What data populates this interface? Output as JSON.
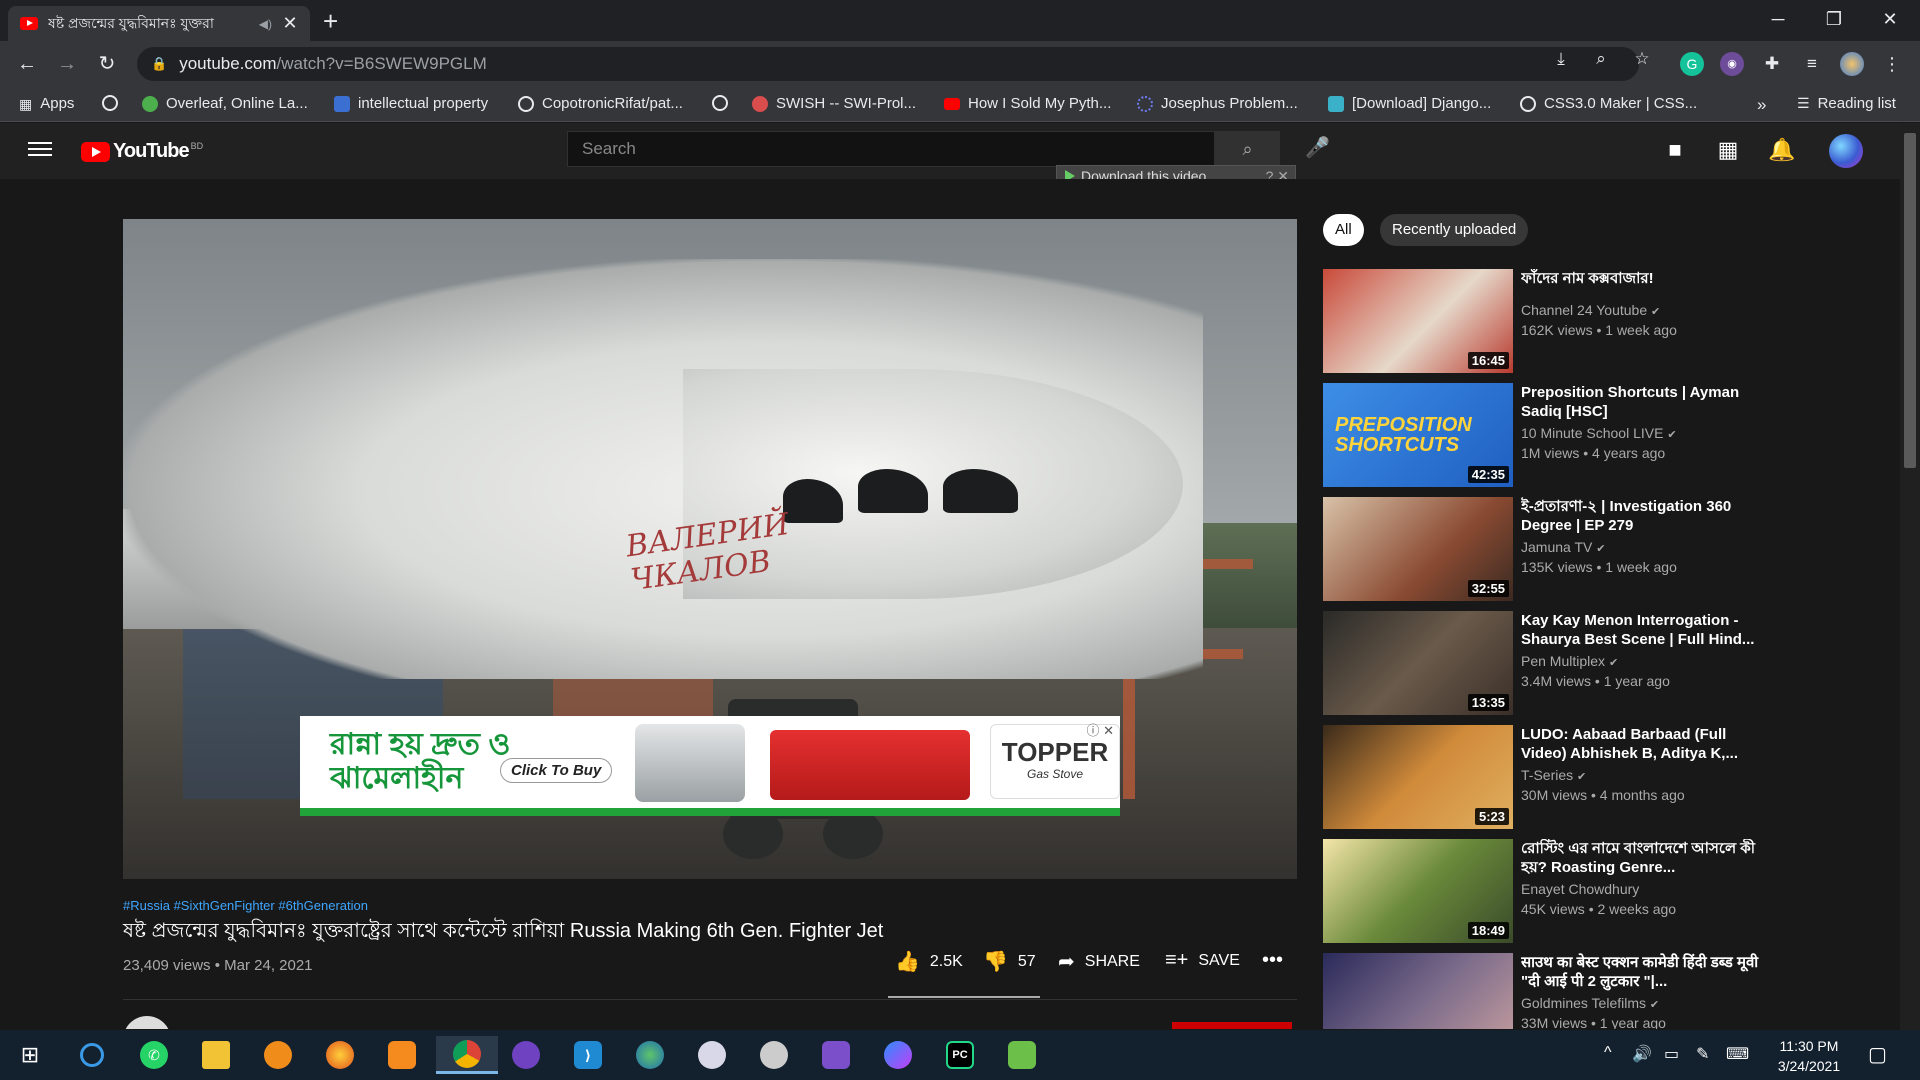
{
  "browser": {
    "tab_title": "ষষ্ট প্রজন্মের যুদ্ধবিমানঃ যুক্তরা",
    "tab_audio_icon": "speaker-icon",
    "url_host": "youtube.com",
    "url_path": "/watch?v=B6SWEW9PGLM",
    "bookmarks": [
      {
        "label": "Apps",
        "color": "#4285f4"
      },
      {
        "label": "",
        "color": "#e8eaed"
      },
      {
        "label": "Overleaf, Online La...",
        "color": "#4cae4c"
      },
      {
        "label": "intellectual property",
        "color": "#3b6fd1"
      },
      {
        "label": "CopotronicRifat/pat...",
        "color": "#e8eaed"
      },
      {
        "label": "",
        "color": "#e8eaed"
      },
      {
        "label": "SWISH -- SWI-Prol...",
        "color": "#d94d4d"
      },
      {
        "label": "How I Sold My Pyth...",
        "color": "#ff0000"
      },
      {
        "label": "Josephus Problem...",
        "color": "#6f7cf0"
      },
      {
        "label": "[Download] Django...",
        "color": "#3bb0c9"
      },
      {
        "label": "CSS3.0 Maker | CSS...",
        "color": "#e8eaed"
      }
    ],
    "more_bookmarks": "»",
    "reading_list": "Reading list"
  },
  "youtube": {
    "country_code": "BD",
    "logo_text": "YouTube",
    "search_placeholder": "Search",
    "download_bar": "Download this video",
    "chips": [
      "All",
      "Recently uploaded"
    ]
  },
  "video": {
    "hashtags": "#Russia #SixthGenFighter #6thGeneration",
    "title": "ষষ্ট প্রজন্মের যুদ্ধবিমানঃ যুক্তরাষ্ট্রের সাথে কন্টেস্টে রাশিয়া Russia Making 6th Gen. Fighter Jet",
    "views_date": "23,409 views • Mar 24, 2021",
    "likes": "2.5K",
    "dislikes": "57",
    "share_label": "SHARE",
    "save_label": "SAVE",
    "plane_text_line1": "ВАЛЕРИЙ",
    "plane_text_line2": "ЧКАЛОВ",
    "ad": {
      "headline_line1": "রান্না হয় দ্রুত ও",
      "headline_line2": "ঝামেলাহীন",
      "cta": "Click To Buy",
      "brand": "TOPPER",
      "brand_sub": "Gas Stove"
    }
  },
  "recommendations": [
    {
      "title": "ফাঁদের নাম কক্সবাজার!",
      "channel": "Channel 24 Youtube",
      "meta": "162K views • 1 week ago",
      "duration": "16:45",
      "thumb_color": "#b83a2e"
    },
    {
      "title": "Preposition Shortcuts | Ayman Sadiq [HSC]",
      "channel": "10 Minute School LIVE",
      "meta": "1M views • 4 years ago",
      "duration": "42:35",
      "thumb_color": "#1f6fd1",
      "thumb_text": "PREPOSITION SHORTCUTS"
    },
    {
      "title": "ই-প্রতারণা-২ | Investigation 360 Degree | EP 279",
      "channel": "Jamuna TV",
      "meta": "135K views • 1 week ago",
      "duration": "32:55",
      "thumb_color": "#7a3b2a"
    },
    {
      "title": "Kay Kay Menon Interrogation - Shaurya Best Scene | Full Hind...",
      "channel": "Pen Multiplex",
      "meta": "3.4M views • 1 year ago",
      "duration": "13:35",
      "thumb_color": "#5a4a3c"
    },
    {
      "title": "LUDO: Aabaad Barbaad (Full Video) Abhishek B, Aditya K,...",
      "channel": "T-Series",
      "meta": "30M views • 4 months ago",
      "duration": "5:23",
      "thumb_color": "#b4702c"
    },
    {
      "title": "রোস্টিং এর নামে বাংলাদেশে আসলে কী হয়? Roasting Genre...",
      "channel": "Enayet Chowdhury",
      "meta": "45K views • 2 weeks ago",
      "duration": "18:49",
      "thumb_color": "#c9a23a"
    },
    {
      "title": "साउथ का बेस्ट एक्शन कामेडी हिंदी डब्ड मूवी \"दी आई पी 2 लुटकार \"|...",
      "channel": "Goldmines Telefilms",
      "meta": "33M views • 1 year ago",
      "duration": "",
      "thumb_color": "#6a5a7a"
    }
  ],
  "taskbar": {
    "time": "11:30 PM",
    "date": "3/24/2021"
  }
}
